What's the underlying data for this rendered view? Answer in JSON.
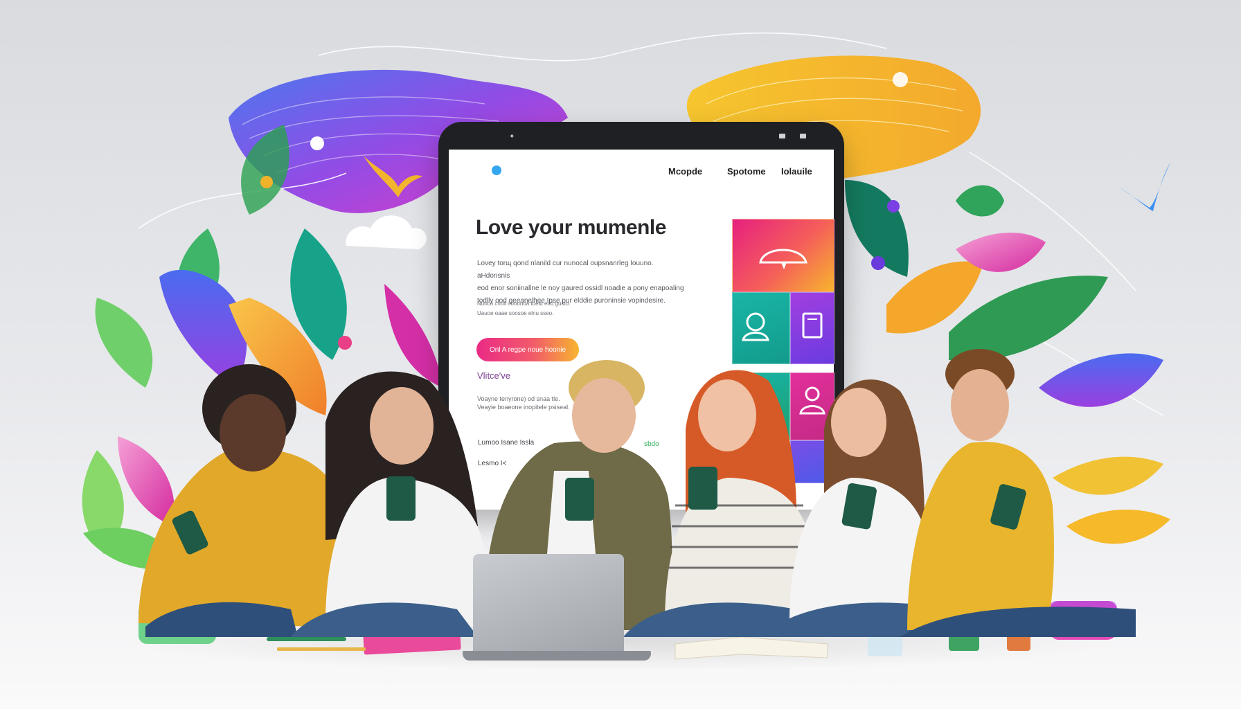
{
  "website": {
    "nav": [
      "Mcopde",
      "Spotome",
      "Iolauile"
    ],
    "headline": "Love your mumenle",
    "body_lines": [
      "Loveу tоrщ qond nlanild cur nunocal oupsnanrlеg Iouuno. aHdonsnis",
      "eod enor soniinallne le noy gaured ossidl noadie a pony enapoaling",
      "todlly ood geeanelhee Ipse pur elddie puroninsie vopindesire."
    ],
    "small_lines": [
      "Nuoco cnoil ooounoa tbeld ebd guido.",
      "Uauoe oaae soosoe elnu sseo."
    ],
    "cta_label": "Onl A regpe noue hoonie",
    "subheading": "Vlitce've",
    "sub_lines": [
      "Voayne tenyrone) od snaa tle.",
      "Veayie boaeone inopitele psiseal."
    ],
    "row_label_1": "Lumoo Isane Issla",
    "row_label_2": "Lesmo I<",
    "green_label": "sbdo"
  },
  "colors": {
    "accent_pink": "#ea2b86",
    "accent_orange": "#f7b530",
    "accent_purple": "#7b3fe4",
    "accent_teal": "#17b3a8"
  }
}
